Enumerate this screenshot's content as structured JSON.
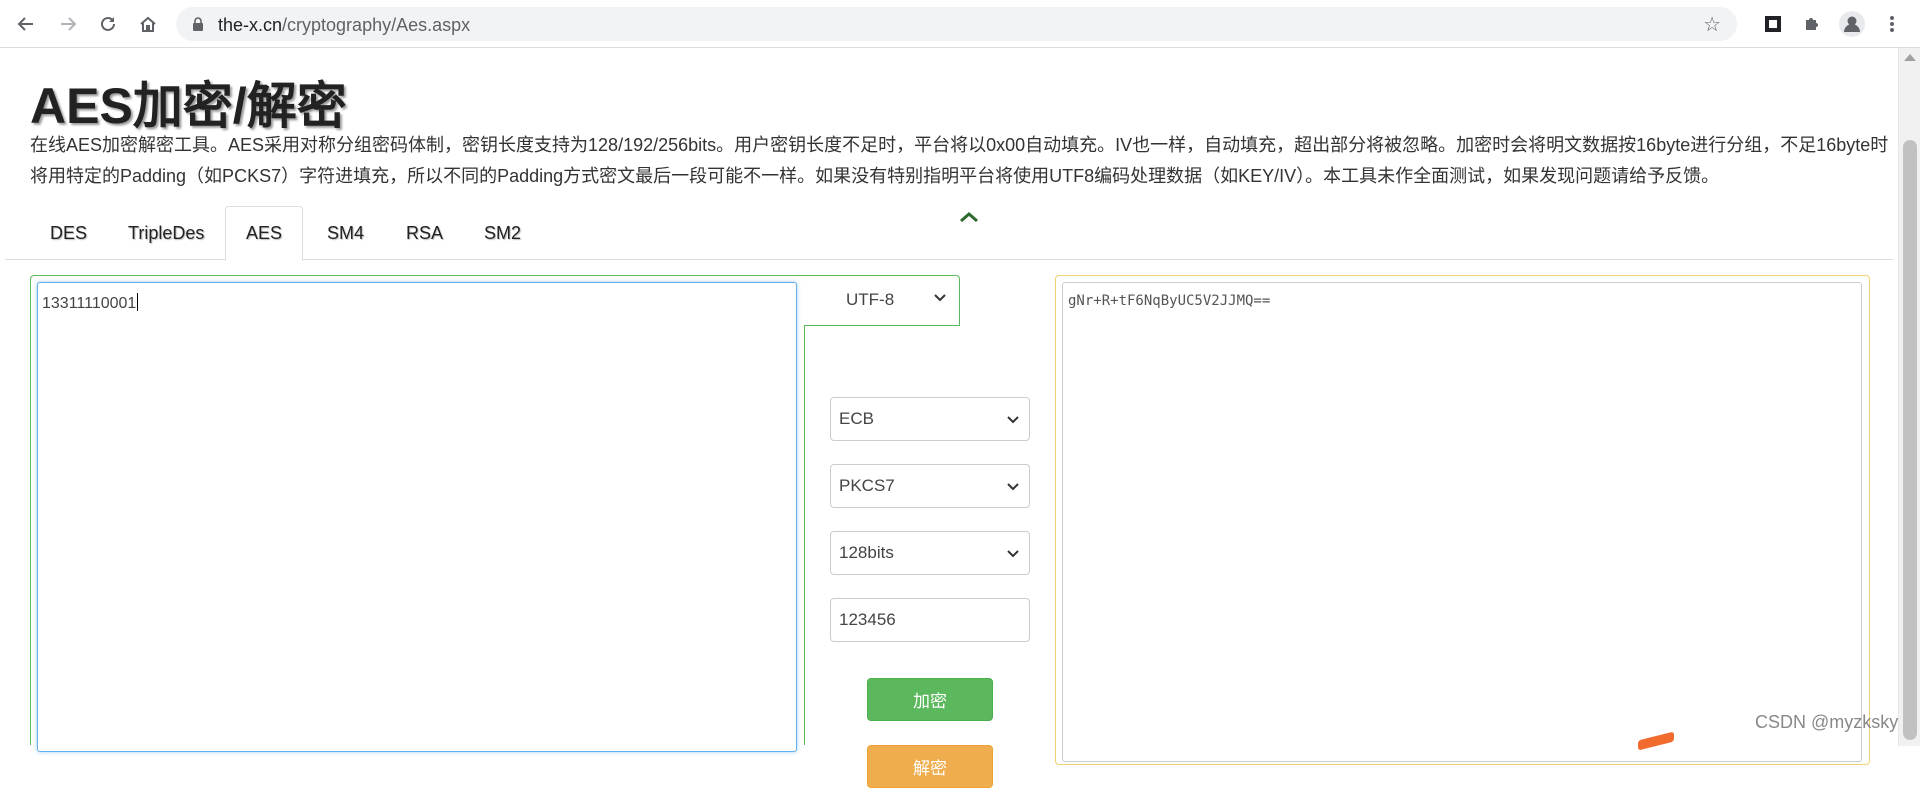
{
  "browser": {
    "url_domain": "the-x.cn",
    "url_path": "/cryptography/Aes.aspx"
  },
  "page": {
    "title": "AES加密/解密",
    "description": "在线AES加密解密工具。AES采用对称分组密码体制，密钥长度支持为128/192/256bits。用户密钥长度不足时，平台将以0x00自动填充。IV也一样，自动填充，超出部分将被忽略。加密时会将明文数据按16byte进行分组，不足16byte时将用特定的Padding（如PCKS7）字符进填充，所以不同的Padding方式密文最后一段可能不一样。如果没有特别指明平台将使用UTF8编码处理数据（如KEY/IV）。本工具未作全面测试，如果发现问题请给予反馈。"
  },
  "tabs": [
    "DES",
    "TripleDes",
    "AES",
    "SM4",
    "RSA",
    "SM2"
  ],
  "active_tab": "AES",
  "input": {
    "value": "13311110001"
  },
  "encoding": {
    "value": "UTF-8"
  },
  "controls": {
    "mode": "ECB",
    "padding": "PKCS7",
    "key_size": "128bits",
    "key": "123456"
  },
  "buttons": {
    "encrypt": "加密",
    "decrypt": "解密"
  },
  "output": {
    "value": "gNr+R+tF6NqByUC5V2JJMQ=="
  },
  "watermark": "CSDN @myzksky",
  "colors": {
    "green": "#5cb85c",
    "orange": "#f0ad4e",
    "focus_blue": "#66afe9"
  },
  "icons": [
    "back-icon",
    "forward-icon",
    "reload-icon",
    "home-icon",
    "lock-icon",
    "star-icon",
    "extension-square-icon",
    "puzzle-icon",
    "profile-icon",
    "menu-icon",
    "chevron-up-icon",
    "chevron-down-icon"
  ]
}
